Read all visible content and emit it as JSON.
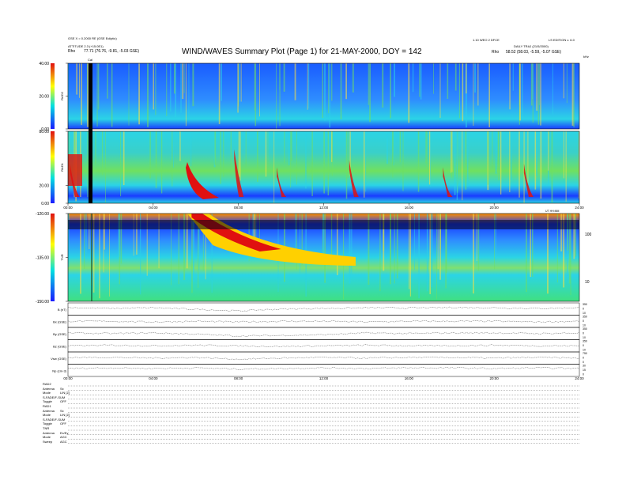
{
  "header": {
    "title": "WIND/WAVES Summary Plot (Page 1) for 21-MAY-2000, DOY = 142",
    "left_line1": "GSE X = 0.2000 RE (GSE Ecliptic)",
    "left_line2": "ATTITUDE 2.3 (+15.0E1)",
    "left_rho_label": "Rho",
    "left_rho_value": "77.71 (76.76, -9.81, -5.03 GSE)",
    "right_line1": "1.10 WEO 2 DFCE",
    "right_line2": "LS EDITION v. 6.0",
    "right_line3": "DAILY TRAJ (21/5/2000)",
    "right_rho_label": "Rho",
    "right_rho_value": "58.52 (58.03, -5.59, -5.07 GSE)",
    "cal_marker": "Cal",
    "right_mhz_label": "kHz"
  },
  "chart_data": [
    {
      "type": "heatmap",
      "panel": "RAD2",
      "ylabel": "RAD2",
      "y_ticks": [
        "0.00",
        "20.00",
        "40.00"
      ],
      "ylim": [
        0,
        40
      ],
      "colorbar_range": [
        0,
        40
      ],
      "x_range_hours": [
        0,
        24
      ]
    },
    {
      "type": "heatmap",
      "panel": "RAD1",
      "ylabel": "RAD1",
      "y_ticks": [
        "0.00",
        "20.00",
        "80.00"
      ],
      "ylim": [
        0,
        80
      ],
      "colorbar_range": [
        0,
        80
      ],
      "x_ticks": [
        "00:00",
        "04:00",
        "08:00",
        "12:00",
        "16:00",
        "20:00",
        "24:00"
      ],
      "x_range_hours": [
        0,
        24
      ],
      "x_unit_label": "UT HH:MM"
    },
    {
      "type": "heatmap",
      "panel": "TNR",
      "ylabel": "TNR",
      "y_ticks": [
        "-150.00",
        "-135.00",
        "-120.00"
      ],
      "ylim": [
        -150,
        -120
      ],
      "right_ticks": [
        "100",
        "10"
      ],
      "x_range_hours": [
        0,
        24
      ]
    },
    {
      "type": "line",
      "panel": "magnetometer",
      "series": [
        {
          "name": "B (nT)",
          "right_ticks": [
            "350",
            "0",
            "10"
          ],
          "x_hours": [
            0,
            2,
            4,
            6,
            8,
            10,
            12,
            14,
            16,
            18,
            20,
            22,
            24
          ],
          "values": [
            0.62,
            0.55,
            0.6,
            0.48,
            0.35,
            0.5,
            0.55,
            0.6,
            0.58,
            0.62,
            0.6,
            0.55,
            0.6
          ]
        },
        {
          "name": "Bx (GSE)",
          "right_ticks": [
            "350",
            "0",
            "10"
          ],
          "x_hours": [
            0,
            2,
            4,
            6,
            8,
            10,
            12,
            14,
            16,
            18,
            20,
            22,
            24
          ],
          "values": [
            0.5,
            0.5,
            0.45,
            0.5,
            0.45,
            0.5,
            0.5,
            0.45,
            0.5,
            0.5,
            0.5,
            0.45,
            0.5
          ]
        },
        {
          "name": "By (GSE)",
          "right_ticks": [
            "350",
            "0",
            "10"
          ],
          "x_hours": [
            0,
            2,
            4,
            6,
            8,
            10,
            12,
            14,
            16,
            18,
            20,
            22,
            24
          ],
          "values": [
            0.55,
            0.5,
            0.55,
            0.45,
            0.3,
            0.35,
            0.4,
            0.55,
            0.5,
            0.55,
            0.55,
            0.5,
            0.55
          ]
        },
        {
          "name": "Bz (GSE)",
          "right_ticks": [
            "350",
            "0",
            "10"
          ],
          "x_hours": [
            0,
            2,
            4,
            6,
            8,
            10,
            12,
            14,
            16,
            18,
            20,
            22,
            24
          ],
          "values": [
            0.5,
            0.55,
            0.5,
            0.55,
            0.5,
            0.45,
            0.5,
            0.55,
            0.5,
            0.5,
            0.55,
            0.5,
            0.5
          ]
        },
        {
          "name": "Vsw (GSE)",
          "right_ticks": [
            "750",
            "0",
            "0"
          ],
          "x_hours": [
            0,
            2,
            4,
            6,
            8,
            10,
            12,
            14,
            16,
            18,
            20,
            22,
            24
          ],
          "values": [
            0.55,
            0.55,
            0.5,
            0.55,
            0.4,
            0.5,
            0.55,
            0.5,
            0.55,
            0.55,
            0.5,
            0.55,
            0.5
          ]
        },
        {
          "name": "Np (cm-3)",
          "right_ticks": [
            "30",
            "15",
            "0"
          ],
          "x_hours": [
            0,
            2,
            4,
            6,
            8,
            10,
            12,
            14,
            16,
            18,
            20,
            22,
            24
          ],
          "values": [
            0.65,
            0.7,
            0.65,
            0.7,
            0.6,
            0.65,
            0.7,
            0.65,
            0.7,
            0.7,
            0.65,
            0.7,
            0.65
          ]
        }
      ],
      "x_ticks": [
        "00:00",
        "04:00",
        "08:00",
        "12:00",
        "16:00",
        "20:00",
        "24:00"
      ],
      "x_range_hours": [
        0,
        24
      ]
    }
  ],
  "footer": {
    "rad2": {
      "heading": "RAD2",
      "rows": [
        [
          "Antenna",
          "Sx"
        ],
        [
          "Mode",
          "LIN [Z]"
        ],
        [
          "S-FADE/F-SUM",
          ""
        ],
        [
          "Toggle",
          "OFF"
        ]
      ]
    },
    "rad1": {
      "heading": "RAD1",
      "rows": [
        [
          "Antenna",
          "Sx"
        ],
        [
          "Mode",
          "LIN [Z]"
        ],
        [
          "S-FADE/F-SUM",
          ""
        ],
        [
          "Toggle",
          "OFF"
        ]
      ]
    },
    "tnr": {
      "heading": "TNR",
      "rows": [
        [
          "Antenna",
          "Ex/Ey"
        ],
        [
          "Mode",
          "AGC"
        ],
        [
          "Sweep",
          "AGC"
        ]
      ]
    }
  },
  "colors": {
    "low": "#1a1aff",
    "mid": "#00e0e0",
    "high": "#ffd000",
    "peak": "#e01010",
    "background": "#ffffff"
  }
}
